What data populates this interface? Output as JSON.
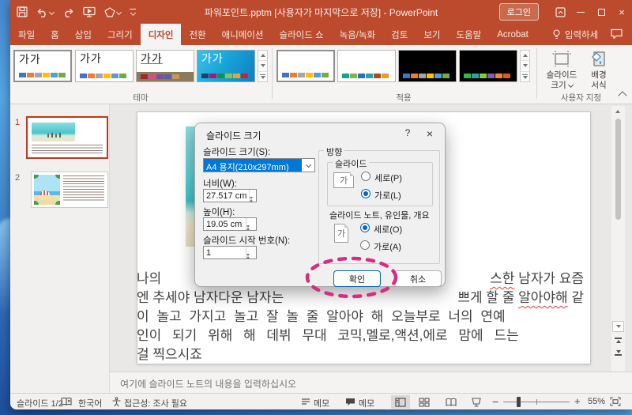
{
  "window": {
    "title": "파워포인트.pptm [사용자가 마지막으로 저장] - PowerPoint",
    "login_label": "로그인"
  },
  "ribbon": {
    "tabs": [
      "파일",
      "홈",
      "삽입",
      "그리기",
      "디자인",
      "전환",
      "애니메이션",
      "슬라이드 쇼",
      "녹음/녹화",
      "검토",
      "보기",
      "도움말",
      "Acrobat"
    ],
    "active_tab": "디자인",
    "tellme_label": "입력하세",
    "theme_sample_text": "가가",
    "themes_group_label": "테마",
    "variants_group_label": "적용",
    "custom_group_label": "사용자 지정",
    "slide_size_line1": "슬라이드",
    "slide_size_line2": "크기",
    "background_line1": "배경",
    "background_line2": "서식"
  },
  "swatches": {
    "office": [
      "#4472c4",
      "#ed7d31",
      "#a5a5a5",
      "#ffc000",
      "#5b9bd5",
      "#70ad47"
    ],
    "warm": [
      "#9e2a2b",
      "#d45087",
      "#7d4fa0",
      "#5c5fa8",
      "#c99a4a"
    ],
    "blue": [
      "#17406d",
      "#a21d6a",
      "#1e8a4c",
      "#8cc63e",
      "#f0a030",
      "#cf2030"
    ],
    "teal": [
      "#1d9f8f",
      "#7ab648",
      "#2f6eb5",
      "#27a3a5",
      "#b04a17",
      "#e0a02e"
    ],
    "dark2": [
      "#35b44a",
      "#2aa79b",
      "#8cc63e",
      "#7e5bb5",
      "#f0882f",
      "#e25822"
    ]
  },
  "thumbnails": {
    "slide1_number": "1",
    "slide2_number": "2"
  },
  "slide": {
    "l1a": "나의",
    "l1b": "스한",
    "l1c": " 남자가 요즘",
    "l2a": "엔 추세야 남자다운 남자는",
    "l2b": "쁘게 할 줄 ",
    "l2c": "알아야해",
    "l2d": " 같",
    "l3": "이 놀고 가지고 놀고 잘 놀 줄 알아야 해 오늘부로 너의 연예",
    "l4": "인이 되기 위해 해 데뷔 무대 코믹,멜로,액션,에로 맘에 드는",
    "l5": "걸 찍으시죠"
  },
  "notes": {
    "placeholder": "여기에 슬라이드 노트의 내용을 입력하십시오"
  },
  "dialog": {
    "title": "슬라이드 크기",
    "help_glyph": "?",
    "close_glyph": "×",
    "size_label": "슬라이드 크기(S):",
    "size_value": "A4 용지(210x297mm)",
    "width_label": "너비(W):",
    "width_value": "27.517 cm",
    "height_label": "높이(H):",
    "height_value": "19.05 cm",
    "start_number_label": "슬라이드 시작 번호(N):",
    "start_number_value": "1",
    "orientation_label": "방향",
    "slides_group_label": "슬라이드",
    "slides_portrait": "세로(P)",
    "slides_landscape": "가로(L)",
    "notes_group_label": "슬라이드 노트, 유인물, 개요",
    "notes_portrait": "세로(O)",
    "notes_landscape": "가로(A)",
    "icon_glyph": "가",
    "ok_label": "확인",
    "cancel_label": "취소",
    "annotation_color": "#d42e80"
  },
  "statusbar": {
    "slide_indicator": "슬라이드 1/2",
    "language": "한국어",
    "accessibility": "접근성: 조사 필요",
    "notes_button": "메모",
    "comments_button": "메모",
    "zoom_percent": "55%"
  }
}
